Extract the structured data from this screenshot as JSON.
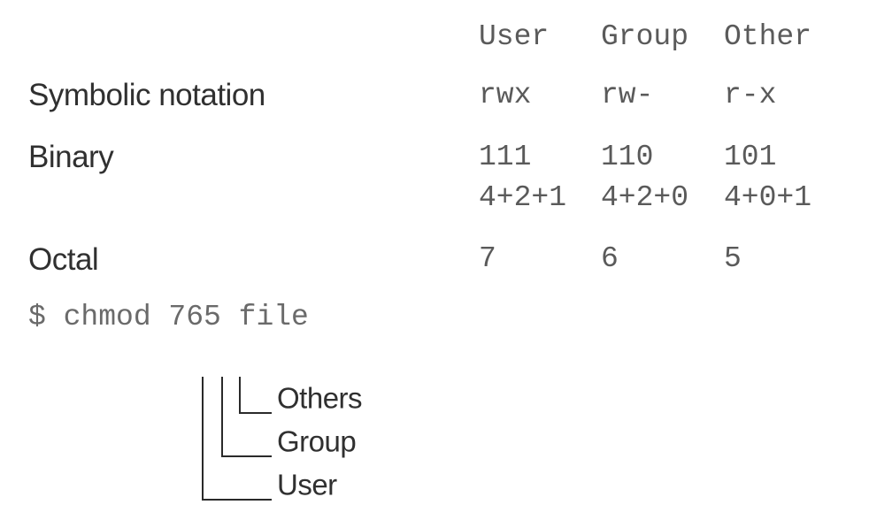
{
  "columns": [
    "User",
    "Group",
    "Other"
  ],
  "rows": {
    "symbolic": {
      "label": "Symbolic notation",
      "values": [
        "rwx",
        "rw-",
        "r-x"
      ]
    },
    "binary": {
      "label": "Binary",
      "values": [
        "111",
        "110",
        "101"
      ],
      "sums": [
        "4+2+1",
        "4+2+0",
        "4+0+1"
      ]
    },
    "octal": {
      "label": "Octal",
      "values": [
        "7",
        "6",
        "5"
      ]
    }
  },
  "command": "$ chmod 765 file",
  "legend": {
    "others": "Others",
    "group": "Group",
    "user": "User"
  },
  "colors": {
    "label_text": "#303030",
    "mono_text": "#5a5a5a",
    "bracket_lines": "#2a2a2a"
  }
}
